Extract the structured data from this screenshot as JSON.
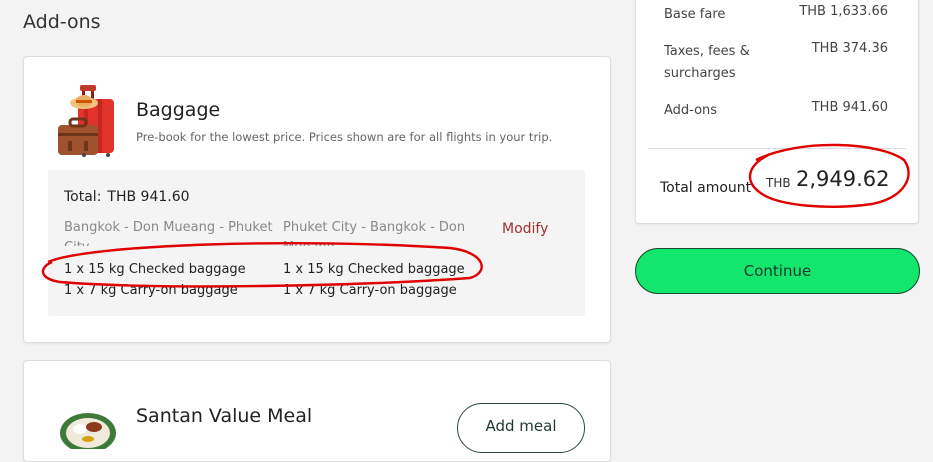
{
  "section_title": "Add-ons",
  "baggage": {
    "title": "Baggage",
    "subtitle": "Pre-book for the lowest price. Prices shown are for all flights in your trip.",
    "total_label": "Total:",
    "total_value": "THB 941.60",
    "modify_label": "Modify",
    "flights": [
      {
        "route": "Bangkok - Don Mueang - Phuket City",
        "checked": "1 x 15 kg Checked baggage",
        "carry_on": "1 x 7 kg Carry-on baggage"
      },
      {
        "route": "Phuket City - Bangkok - Don Mueang",
        "checked": "1 x 15 kg Checked baggage",
        "carry_on": "1 x 7 kg Carry-on baggage"
      }
    ]
  },
  "meal": {
    "title": "Santan Value Meal",
    "add_label": "Add meal"
  },
  "summary": {
    "base_fare_label": "Base fare",
    "base_fare_value": "THB 1,633.66",
    "taxes_label": "Taxes, fees & surcharges",
    "taxes_value": "THB 374.36",
    "addons_label": "Add-ons",
    "addons_value": "THB 941.60",
    "total_label": "Total amount",
    "total_currency": "THB",
    "total_amount": "2,949.62"
  },
  "continue_label": "Continue",
  "icons": [
    "luggage-icon",
    "meal-icon"
  ],
  "colors": {
    "accent_green": "#12e66d",
    "modify_red": "#a0302b",
    "annotation_red": "#e00000"
  }
}
